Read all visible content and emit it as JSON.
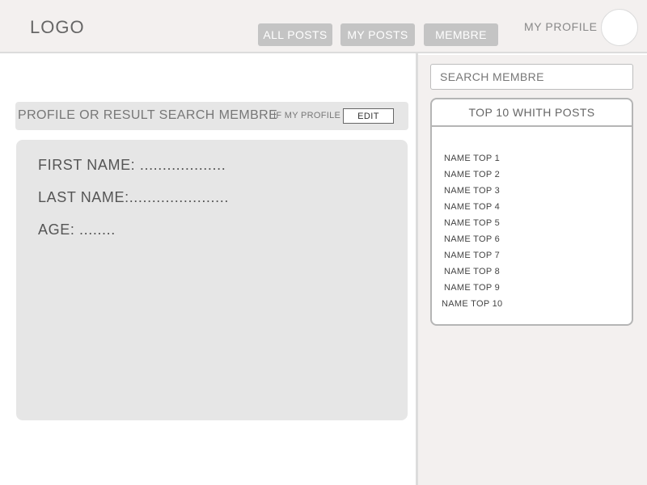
{
  "header": {
    "logo": "LOGO",
    "nav": [
      {
        "label": "ALL POSTS"
      },
      {
        "label": "MY POSTS"
      },
      {
        "label": "MEMBRE"
      }
    ],
    "profile_label": "MY PROFILE"
  },
  "sidebar": {
    "search": {
      "placeholder": "SEARCH MEMBRE"
    },
    "top_box": {
      "title": "TOP 10 WHITH POSTS",
      "items": [
        {
          "name": "NAME TOP 1"
        },
        {
          "name": "NAME TOP 2"
        },
        {
          "name": "NAME TOP 3"
        },
        {
          "name": "NAME TOP 4"
        },
        {
          "name": "NAME TOP 5"
        },
        {
          "name": "NAME TOP 6"
        },
        {
          "name": "NAME TOP 7"
        },
        {
          "name": "NAME TOP 8"
        },
        {
          "name": "NAME TOP 9"
        },
        {
          "name": "NAME TOP 10"
        }
      ]
    }
  },
  "main": {
    "bar_title": "PROFILE OR RESULT SEARCH MEMBRE",
    "if_label": "IF MY PROFILE",
    "edit_label": "EDIT",
    "fields": [
      {
        "text": "FIRST NAME: ..................."
      },
      {
        "text": "LAST NAME:......................"
      },
      {
        "text": "AGE: ........"
      }
    ]
  }
}
